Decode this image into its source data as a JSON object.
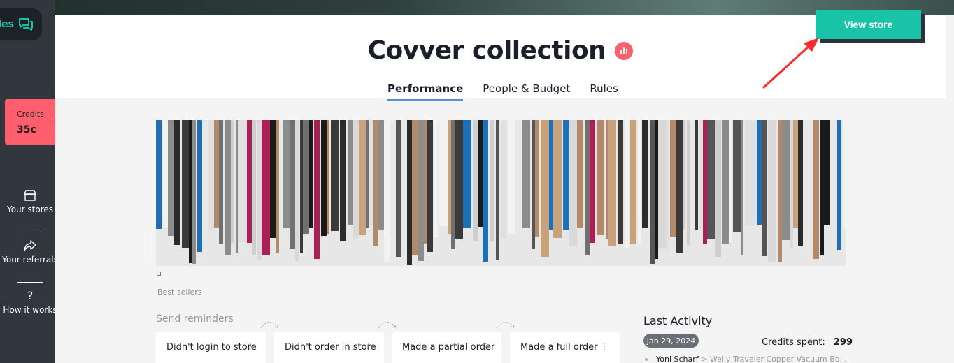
{
  "sidebar": {
    "chat_partial_label": "les",
    "credits": {
      "label": "Credits",
      "value": "35c",
      "add_symbol": "+"
    },
    "nav": [
      {
        "label": "Your stores",
        "icon": "store-icon"
      },
      {
        "label": "Your referrals",
        "icon": "share-arrow-icon"
      },
      {
        "label": "How it works",
        "icon": "question-icon"
      }
    ]
  },
  "header": {
    "title": "Covver collection",
    "view_store_label": "View store",
    "tabs": [
      {
        "label": "Performance",
        "active": true
      },
      {
        "label": "People & Budget",
        "active": false
      },
      {
        "label": "Rules",
        "active": false
      }
    ]
  },
  "collage": {
    "caption": "Best sellers"
  },
  "reminders": {
    "title": "Send reminders",
    "cards": [
      {
        "label": "Didn't login to store"
      },
      {
        "label": "Didn't order in store"
      },
      {
        "label": "Made a partial order"
      },
      {
        "label": "Made a full order"
      }
    ]
  },
  "activity": {
    "title": "Last Activity",
    "date": "Jan 29, 2024",
    "credits_spent_label": "Credits spent:",
    "credits_spent_value": "299",
    "entry_user": "Yoni Scharf",
    "entry_separator": ">",
    "entry_item": "Welly Traveler Copper Vacuum Bo..."
  },
  "colors": {
    "accent": "#19c3a8",
    "credits_bg": "#ff5e6c",
    "sidebar_bg": "#31363f",
    "tab_underline": "#5a8fd4",
    "arrow": "#ff2a2a"
  }
}
